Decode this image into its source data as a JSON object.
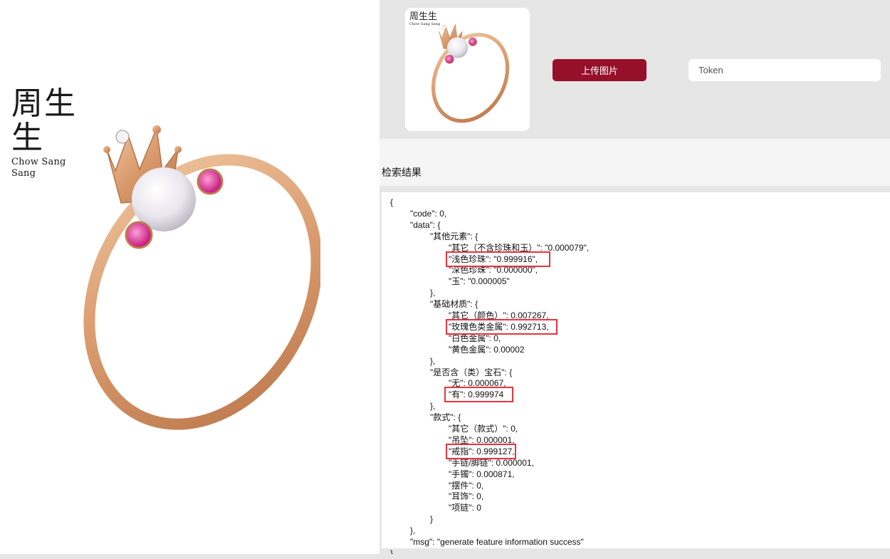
{
  "brand": {
    "name_cn": "周生生",
    "name_en": "Chow Sang Sang"
  },
  "upload": {
    "button_label": "上传图片",
    "token_placeholder": "Token"
  },
  "results": {
    "title": "检索结果",
    "lines": [
      "{",
      "\"code\": 0,",
      "\"data\": {",
      "\"其他元素\": {",
      "\"其它（不含珍珠和玉）\": \"0.000079\",",
      "\"浅色珍珠\": \"0.999916\",",
      "\"深色珍珠\": \"0.000000\",",
      "\"玉\": \"0.000005\"",
      "},",
      "\"基础材质\": {",
      "\"其它（颜色）\": 0.007267,",
      "\"玫瑰色类金属\": 0.992713,",
      "\"白色金属\": 0,",
      "\"黄色金属\": 0.00002",
      "},",
      "\"是否含（类）宝石\": {",
      "\"无\": 0.000067,",
      "\"有\": 0.999974",
      "},",
      "\"款式\": {",
      "\"其它（款式）\": 0,",
      "\"吊坠\": 0.000001,",
      "\"戒指\": 0.999127,",
      "\"手链/脚链\": 0.000001,",
      "\"手镯\": 0.000871,",
      "\"摆件\": 0,",
      "\"耳饰\": 0,",
      "\"项链\": 0",
      "}",
      "},",
      "\"msg\": \"generate feature information success\"",
      "}"
    ]
  },
  "colors": {
    "accent": "#96102a",
    "highlight": "#e8333c",
    "panel_bg": "#e6e6e6"
  }
}
